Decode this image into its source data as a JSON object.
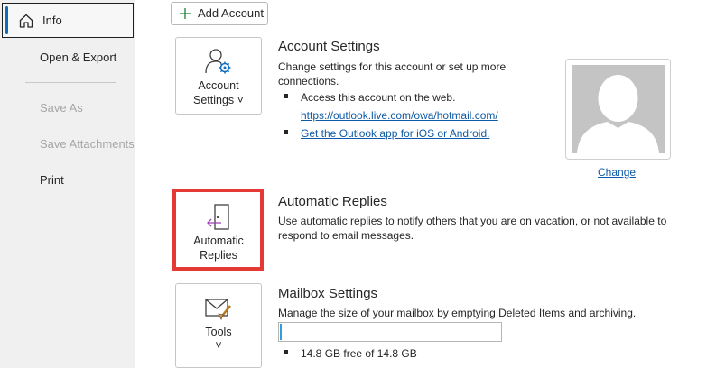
{
  "nav": {
    "items": [
      {
        "label": "Info",
        "selected": true
      },
      {
        "label": "Open & Export"
      },
      {
        "label": "Save As",
        "disabled": true
      },
      {
        "label": "Save Attachments",
        "disabled": true
      },
      {
        "label": "Print"
      }
    ]
  },
  "toolbar": {
    "add_account_label": "Add Account"
  },
  "account_settings": {
    "tile_label_line1": "Account",
    "tile_label_line2": "Settings ˅",
    "title": "Account Settings",
    "description_line1": "Change settings for this account or set up more",
    "description_line2": "connections.",
    "bullet1_text": "Access this account on the web.",
    "bullet1_link": "https://outlook.live.com/owa/hotmail.com/",
    "bullet2_link": "Get the Outlook app for iOS or Android."
  },
  "profile_photo": {
    "change_label": "Change"
  },
  "automatic_replies": {
    "tile_label_line1": "Automatic",
    "tile_label_line2": "Replies",
    "title": "Automatic Replies",
    "description_line1": "Use automatic replies to notify others that you are on vacation, or not available to",
    "description_line2": "respond to email messages."
  },
  "mailbox_settings": {
    "tile_label": "Tools",
    "tile_chevron": "˅",
    "title": "Mailbox Settings",
    "description": "Manage the size of your mailbox by emptying Deleted Items and archiving.",
    "usage_fraction": 0.01,
    "storage_text": "14.8 GB free of 14.8 GB"
  },
  "colors": {
    "accent": "#0f6cbd",
    "link": "#0f5aa6",
    "highlight": "#e53935",
    "progress": "#2f9fd7",
    "auto_reply_arrow": "#9c3fb5"
  },
  "icons": {
    "home": "home-icon",
    "plus": "plus-icon",
    "account": "account-settings-icon",
    "auto_reply": "automatic-replies-icon",
    "tools": "tools-icon",
    "avatar": "avatar-placeholder"
  }
}
